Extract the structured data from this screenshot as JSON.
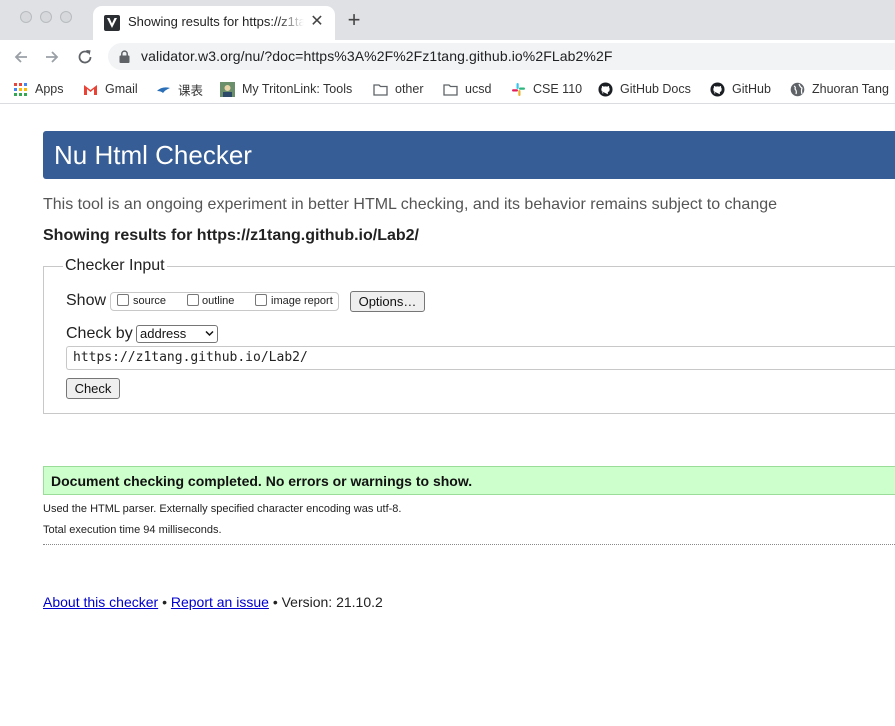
{
  "browser": {
    "tab": {
      "title": "Showing results for https://z1tang.github.io/Lab2/",
      "close": "✕",
      "new_tab": "+"
    },
    "address_bar": {
      "url": "validator.w3.org/nu/?doc=https%3A%2F%2Fz1tang.github.io%2FLab2%2F"
    },
    "bookmarks": [
      {
        "label": "Apps",
        "icon": "apps-grid-icon"
      },
      {
        "label": "Gmail",
        "icon": "gmail-icon"
      },
      {
        "label": "课表",
        "icon": "bird-icon"
      },
      {
        "label": "My TritonLink: Tools",
        "icon": "tritonlink-icon"
      },
      {
        "label": "other",
        "icon": "folder-icon"
      },
      {
        "label": "ucsd",
        "icon": "folder-icon"
      },
      {
        "label": "CSE 110",
        "icon": "slack-icon"
      },
      {
        "label": "GitHub Docs",
        "icon": "github-icon"
      },
      {
        "label": "GitHub",
        "icon": "github-icon"
      },
      {
        "label": "Zhuoran Tang",
        "icon": "globe-icon"
      }
    ]
  },
  "page": {
    "title": "Nu Html Checker",
    "intro": "This tool is an ongoing experiment in better HTML checking, and its behavior remains subject to change",
    "results_for": "Showing results for https://z1tang.github.io/Lab2/",
    "checker_input": {
      "legend": "Checker Input",
      "show_label": "Show",
      "options": [
        {
          "label": "source",
          "checked": false
        },
        {
          "label": "outline",
          "checked": false
        },
        {
          "label": "image report",
          "checked": false
        }
      ],
      "options_button": "Options…",
      "check_by_label": "Check by",
      "check_by_value": "address",
      "url_value": "https://z1tang.github.io/Lab2/",
      "check_button": "Check"
    },
    "result": {
      "message": "Document checking completed. No errors or warnings to show.",
      "parser_info": "Used the HTML parser. Externally specified character encoding was utf-8.",
      "execution_time": "Total execution time 94 milliseconds."
    },
    "footer": {
      "about_link": "About this checker",
      "separator": "•",
      "report_link": "Report an issue",
      "version": "Version: 21.10.2"
    }
  },
  "colors": {
    "banner": "#365d95",
    "success_bg": "#ccffcc",
    "link": "#0000cc"
  }
}
